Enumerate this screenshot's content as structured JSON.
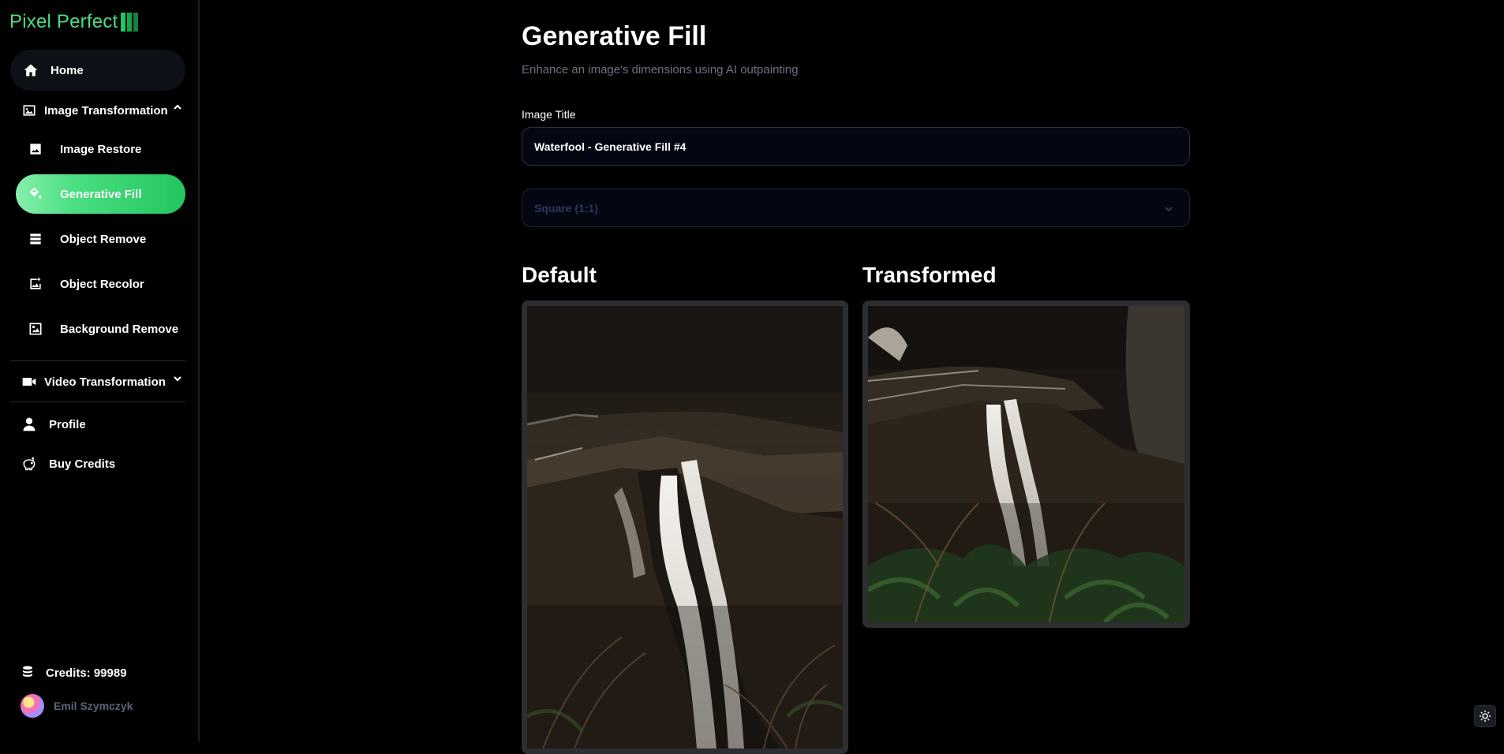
{
  "app": {
    "logo_text": "Pixel Perfect"
  },
  "sidebar": {
    "home": "Home",
    "image_section": "Image Transformation",
    "image_items": [
      {
        "label": "Image Restore",
        "icon": "image-icon"
      },
      {
        "label": "Generative Fill",
        "icon": "paint-bucket-icon",
        "active": true
      },
      {
        "label": "Object Remove",
        "icon": "stack-icon"
      },
      {
        "label": "Object Recolor",
        "icon": "recolor-icon"
      },
      {
        "label": "Background Remove",
        "icon": "image-frame-icon"
      }
    ],
    "video_section": "Video Transformation",
    "profile": "Profile",
    "buy_credits": "Buy Credits",
    "credits_label": "Credits: 99989",
    "user_name": "Emil Szymczyk"
  },
  "main": {
    "title": "Generative Fill",
    "subtitle": "Enhance an image's dimensions using AI outpainting",
    "image_title_label": "Image Title",
    "image_title_value": "Waterfool - Generative Fill #4",
    "aspect_ratio_value": "Square (1:1)",
    "default_heading": "Default",
    "transformed_heading": "Transformed"
  },
  "colors": {
    "accent": "#22c55e",
    "accent_light": "#86efac",
    "background": "#000000",
    "panel_frame": "#2c2e31",
    "muted_text": "#6b7280"
  }
}
